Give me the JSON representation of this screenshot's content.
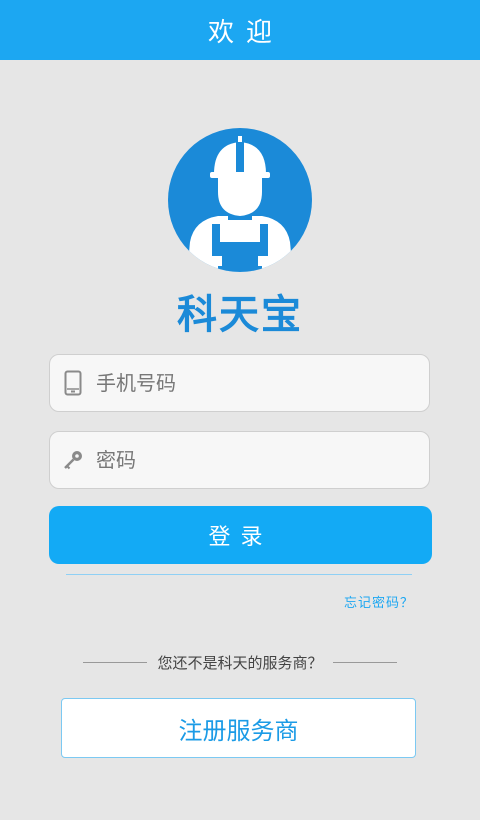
{
  "header": {
    "title": "欢迎"
  },
  "brand": {
    "name": "科天宝"
  },
  "login_form": {
    "phone_placeholder": "手机号码",
    "password_placeholder": "密码",
    "login_label": "登录",
    "forgot_password": "忘记密码？"
  },
  "register": {
    "prompt": "您还不是科天的服务商？",
    "button_label": "注册服务商"
  },
  "icons": {
    "logo": "worker-helmet-icon",
    "phone": "phone-icon",
    "password": "key-icon"
  },
  "colors": {
    "header": "#1ca7f2",
    "brand": "#1b8ad8",
    "primary_button": "#13aaf5",
    "background": "#e6e6e6"
  }
}
